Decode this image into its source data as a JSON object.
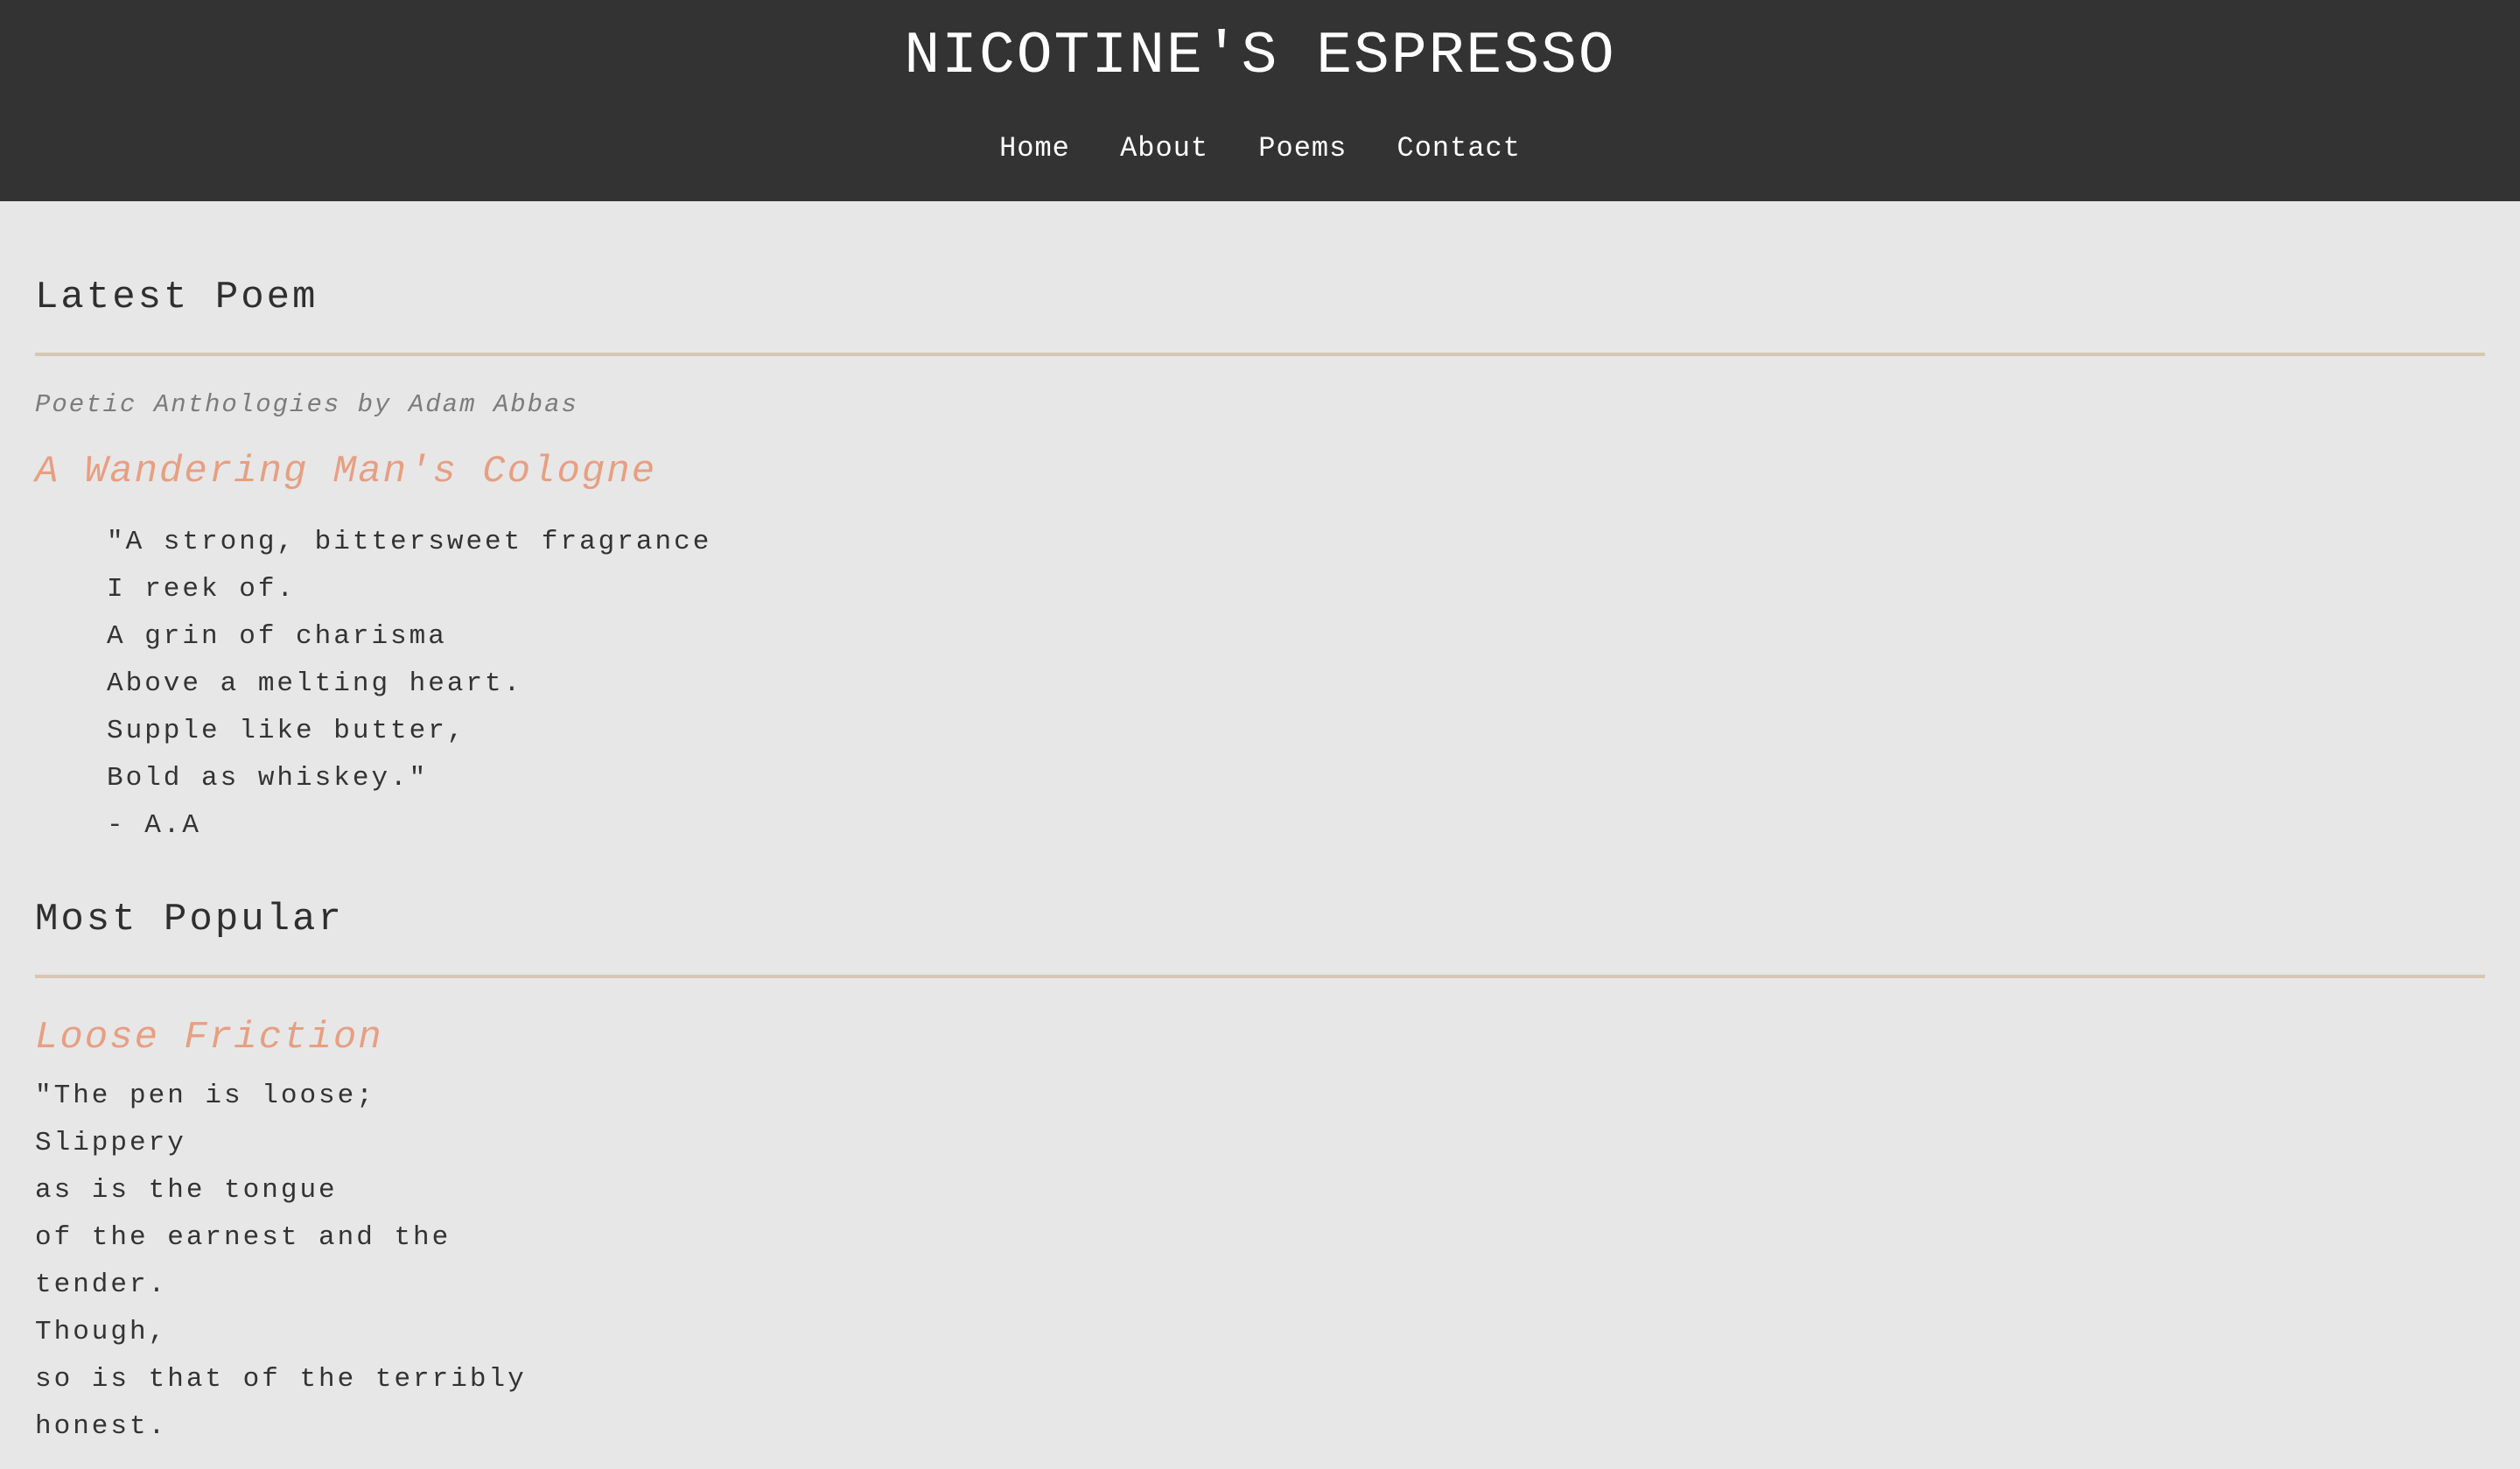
{
  "header": {
    "site_title": "NICOTINE'S ESPRESSO",
    "nav": [
      "Home",
      "About",
      "Poems",
      "Contact"
    ]
  },
  "latest": {
    "section_title": "Latest Poem",
    "byline": "Poetic Anthologies by Adam Abbas",
    "poem_title": "A Wandering Man's Cologne",
    "lines": [
      "\"A strong, bittersweet fragrance",
      "I reek of.",
      "A grin of charisma",
      "Above a melting heart.",
      "Supple like butter,",
      "Bold as whiskey.\"",
      "- A.A"
    ]
  },
  "popular": {
    "section_title": "Most Popular",
    "poem_title": "Loose Friction",
    "lines": [
      "\"The pen is loose;",
      "Slippery",
      "as is the tongue",
      "of the earnest and the",
      "tender.",
      "Though,",
      "so is that of the terribly",
      "honest."
    ]
  },
  "colors": {
    "header_background": "#333333",
    "page_background": "#e7e7e7",
    "accent": "#e79f82",
    "divider": "#d7c7b2"
  }
}
